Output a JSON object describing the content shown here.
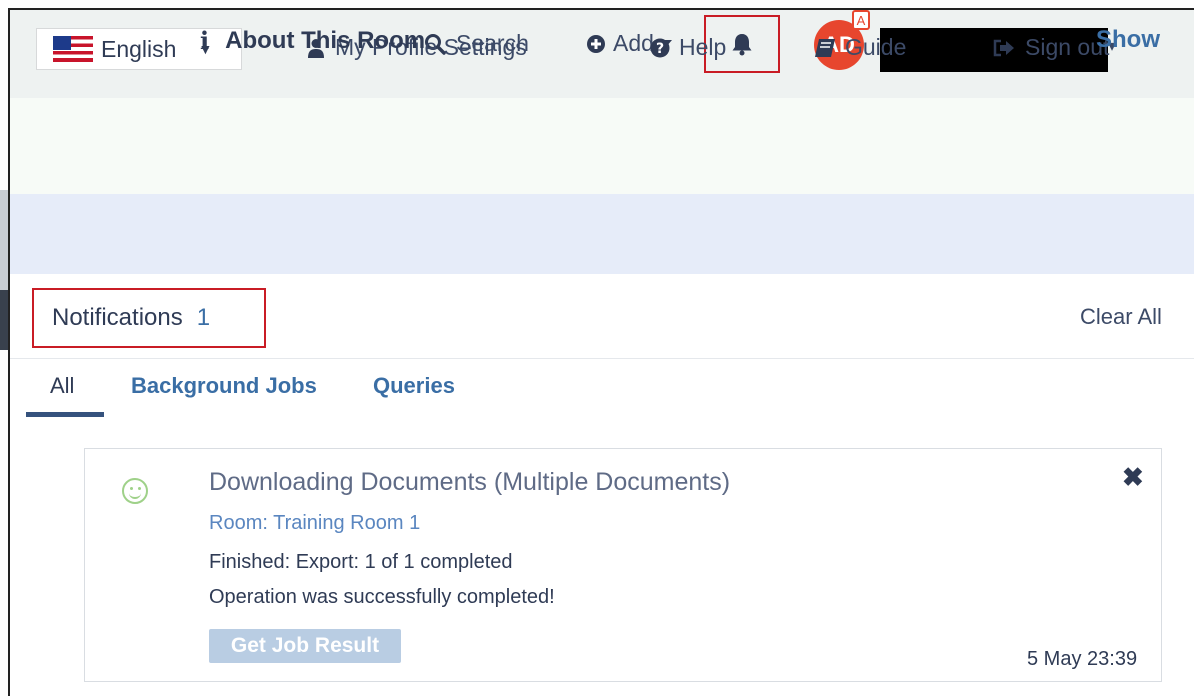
{
  "header": {
    "search_label": "Search",
    "add_label": "Add",
    "avatar_initials": "AD",
    "avatar_badge": "A"
  },
  "secondary_nav": {
    "language": "English",
    "profile": "My Profile Settings",
    "help": "Help",
    "guide": "Guide",
    "signout": "Sign out"
  },
  "about": {
    "title": "About This Room",
    "toggle": "Show"
  },
  "notifications": {
    "title": "Notifications",
    "count": "1",
    "clear_all": "Clear All",
    "tabs": [
      "All",
      "Background Jobs",
      "Queries"
    ],
    "active_tab": "All",
    "items": [
      {
        "title": "Downloading Documents (Multiple Documents)",
        "room": "Room: Training Room 1",
        "status": "Finished: Export: 1 of 1 completed",
        "message": "Operation was successfully completed!",
        "action": "Get Job Result",
        "time": "5 May 23:39"
      }
    ]
  },
  "icons": {
    "search": "search-icon",
    "add": "plus-circle-icon",
    "bell": "bell-icon",
    "user": "user-icon",
    "help": "question-circle-icon",
    "guide": "book-icon",
    "signout": "sign-out-icon",
    "info": "info-icon",
    "success": "smile-icon",
    "close": "close-icon"
  },
  "colors": {
    "accent": "#3a6ea5",
    "highlight_border": "#c91c25",
    "avatar": "#e7462e",
    "success": "#9fd189"
  }
}
